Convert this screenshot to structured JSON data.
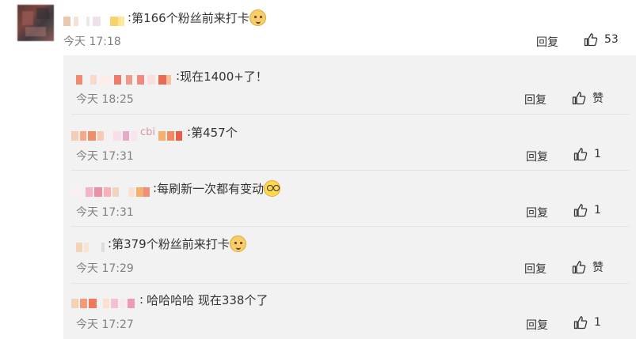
{
  "top_comment": {
    "text": "第166个粉丝前来打卡",
    "emoji": "doge-emoji",
    "time": "今天 17:18",
    "reply_label": "回复",
    "like_count": "53"
  },
  "replies": [
    {
      "text": "现在1400+了！",
      "time": "今天 18:25",
      "reply_label": "回复",
      "like_label": "赞"
    },
    {
      "text": "第457个",
      "nick_fragment": "cbi",
      "time": "今天 17:31",
      "reply_label": "回复",
      "like_label": "1"
    },
    {
      "text": "每刷新一次都有变动",
      "emoji": "glasses-emoji",
      "time": "今天 17:31",
      "reply_label": "回复",
      "like_label": "1"
    },
    {
      "text": "第379个粉丝前来打卡",
      "emoji": "doge-emoji",
      "time": "今天 17:29",
      "reply_label": "回复",
      "like_label": "赞"
    },
    {
      "text": "哈哈哈哈  现在338个了",
      "time": "今天 17:27",
      "reply_label": "回复",
      "like_label": "1"
    }
  ],
  "colors": {
    "background": "#ffffff",
    "replies_background": "#f2f2f2",
    "time_text": "#808080",
    "body_text": "#333333"
  }
}
